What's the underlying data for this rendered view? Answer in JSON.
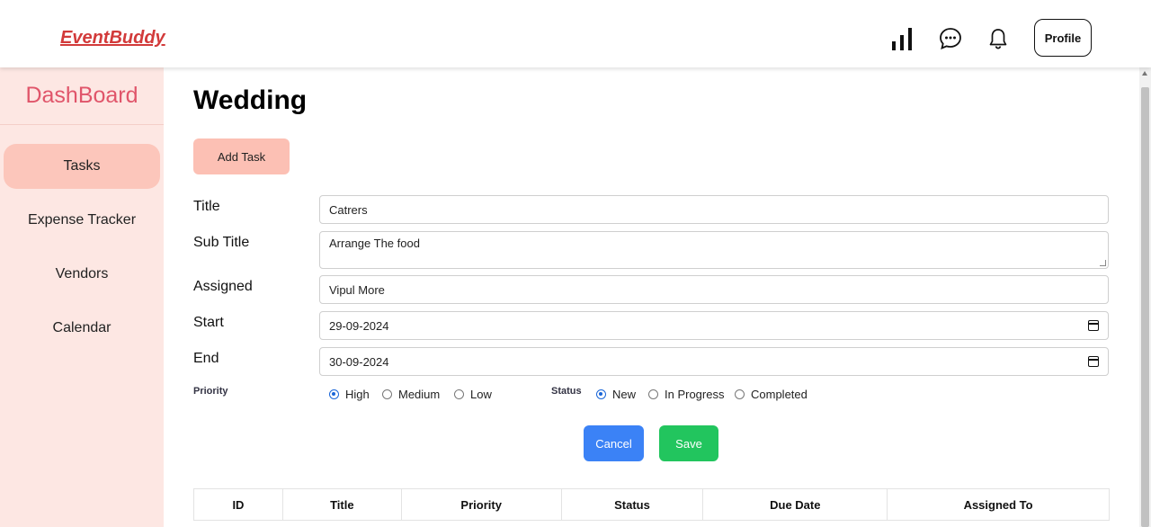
{
  "app": {
    "brand": "EventBuddy"
  },
  "topbar": {
    "icons": [
      "bar-chart-icon",
      "chat-icon",
      "bell-icon"
    ],
    "profile_label": "Profile"
  },
  "sidebar": {
    "title": "DashBoard",
    "items": [
      {
        "label": "Tasks",
        "active": true
      },
      {
        "label": "Expense Tracker",
        "active": false
      },
      {
        "label": "Vendors",
        "active": false
      },
      {
        "label": "Calendar",
        "active": false
      }
    ]
  },
  "main": {
    "title": "Wedding",
    "add_task_label": "Add Task",
    "form": {
      "title_label": "Title",
      "title_value": "Catrers",
      "subtitle_label": "Sub Title",
      "subtitle_value": "Arrange The food",
      "assigned_label": "Assigned",
      "assigned_value": "Vipul More",
      "start_label": "Start",
      "start_value": "29-09-2024",
      "end_label": "End",
      "end_value": "30-09-2024",
      "priority_label": "Priority",
      "priority_options": [
        "High",
        "Medium",
        "Low"
      ],
      "priority_selected": "High",
      "status_label": "Status",
      "status_options": [
        "New",
        "In Progress",
        "Completed"
      ],
      "status_selected": "New"
    },
    "cancel_label": "Cancel",
    "save_label": "Save",
    "table": {
      "columns": [
        "ID",
        "Title",
        "Priority",
        "Status",
        "Due Date",
        "Assigned To"
      ]
    }
  },
  "colors": {
    "brand": "#d23a3a",
    "sidebar_bg": "#fde7e3",
    "sidebar_active": "#fcc6bb",
    "cancel": "#3b82f6",
    "save": "#22c55e",
    "radio_checked": "#1a66d8"
  }
}
